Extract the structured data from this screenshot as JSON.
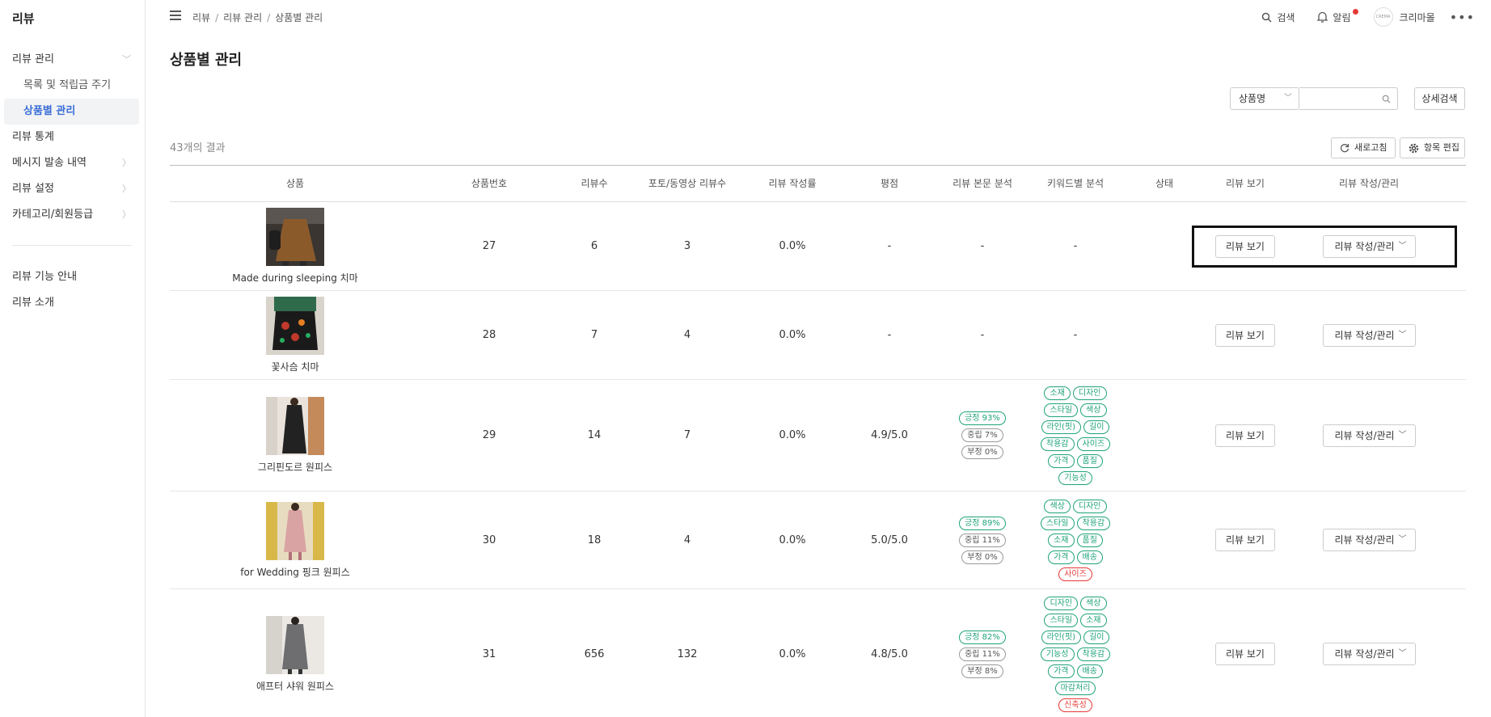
{
  "sidebar": {
    "title": "리뷰",
    "menu": [
      {
        "label": "리뷰 관리",
        "chevron": "down"
      },
      {
        "label": "목록 및 적립금 주기",
        "sub": true
      },
      {
        "label": "상품별 관리",
        "sub": true,
        "active": true
      },
      {
        "label": "리뷰 통계"
      },
      {
        "label": "메시지 발송 내역",
        "chevron": "right"
      },
      {
        "label": "리뷰 설정",
        "chevron": "right"
      },
      {
        "label": "카테고리/회원등급",
        "chevron": "right"
      }
    ],
    "bottom": [
      {
        "label": "리뷰 기능 안내"
      },
      {
        "label": "리뷰 소개"
      }
    ]
  },
  "topbar": {
    "breadcrumb": [
      "리뷰",
      "리뷰 관리",
      "상품별 관리"
    ],
    "search_label": "검색",
    "alert_label": "알림",
    "avatar_text": "CREMA",
    "user_label": "크리마몰",
    "more_label": "•••"
  },
  "main": {
    "title": "상품별 관리",
    "search_select": "상품명",
    "detail_search": "상세검색",
    "result_count": "43개의 결과",
    "refresh": "새로고침",
    "edit_columns": "항목 편집"
  },
  "table": {
    "headers": [
      "상품",
      "상품번호",
      "리뷰수",
      "포토/동영상 리뷰수",
      "리뷰 작성률",
      "평점",
      "리뷰 본문 분석",
      "키워드별 분석",
      "상태",
      "리뷰 보기",
      "리뷰 작성/관리"
    ],
    "view_label": "리뷰 보기",
    "manage_label": "리뷰 작성/관리",
    "rows": [
      {
        "name": "Made during sleeping 치마",
        "no": "27",
        "reviews": "6",
        "photo": "3",
        "rate": "0.0%",
        "score": "-",
        "analysis": "-",
        "keywords_text": "-"
      },
      {
        "name": "꽃사슴 치마",
        "no": "28",
        "reviews": "7",
        "photo": "4",
        "rate": "0.0%",
        "score": "-",
        "analysis": "-",
        "keywords_text": "-"
      },
      {
        "name": "그리핀도르 원피스",
        "no": "29",
        "reviews": "14",
        "photo": "7",
        "rate": "0.0%",
        "score": "4.9/5.0",
        "sentiment": [
          "긍정 93%",
          "중립 7%",
          "부정 0%"
        ],
        "keywords": [
          "소재",
          "디자인",
          "스타일",
          "색상",
          "라인(핏)",
          "길이",
          "착용감",
          "사이즈",
          "가격",
          "품질",
          "기능성"
        ],
        "keywords_red": []
      },
      {
        "name": "for Wedding 핑크 원피스",
        "no": "30",
        "reviews": "18",
        "photo": "4",
        "rate": "0.0%",
        "score": "5.0/5.0",
        "sentiment": [
          "긍정 89%",
          "중립 11%",
          "부정 0%"
        ],
        "keywords": [
          "색상",
          "디자인",
          "스타일",
          "착용감",
          "소재",
          "품질",
          "가격",
          "배송"
        ],
        "keywords_red": [
          "사이즈"
        ]
      },
      {
        "name": "애프터 샤워 원피스",
        "no": "31",
        "reviews": "656",
        "photo": "132",
        "rate": "0.0%",
        "score": "4.8/5.0",
        "sentiment": [
          "긍정 82%",
          "중립 11%",
          "부정 8%"
        ],
        "keywords": [
          "디자인",
          "색상",
          "스타일",
          "소재",
          "라인(핏)",
          "길이",
          "기능성",
          "착용감",
          "가격",
          "배송",
          "마감처리"
        ],
        "keywords_red": [
          "신축성"
        ]
      }
    ]
  },
  "colors": {
    "positive": "#1fa37a",
    "negative": "#e53935",
    "active_menu": "#3a6ed6"
  }
}
